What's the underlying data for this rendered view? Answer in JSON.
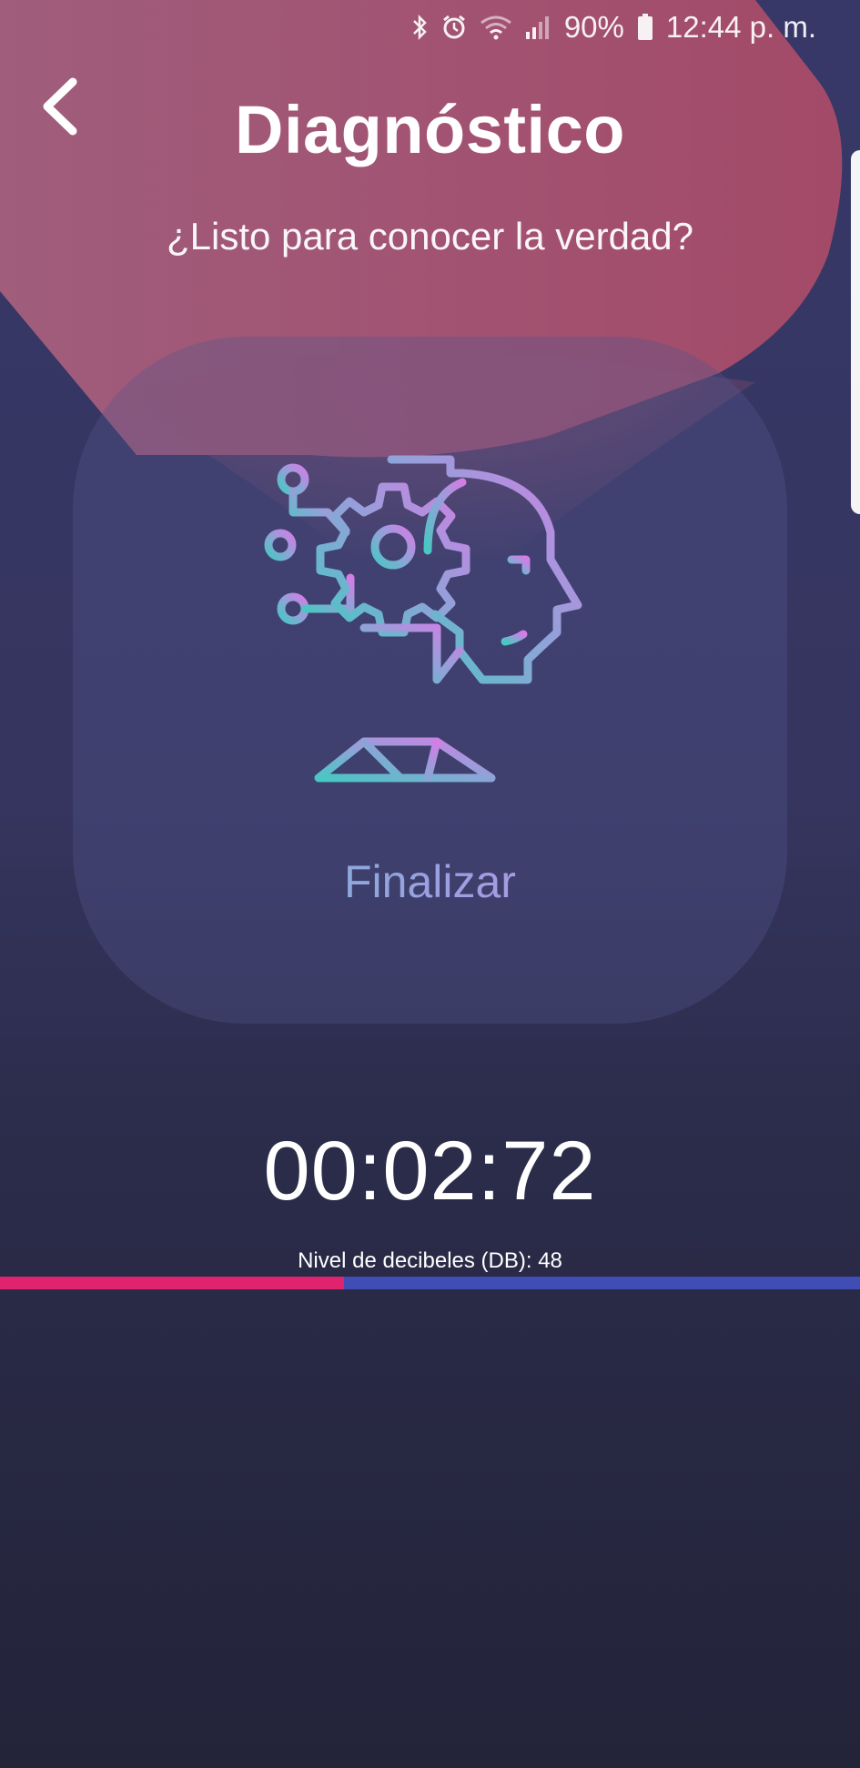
{
  "status_bar": {
    "battery": "90%",
    "time": "12:44 p. m.",
    "icons": [
      "bluetooth-icon",
      "alarm-icon",
      "wifi-icon",
      "signal-icon",
      "battery-icon"
    ]
  },
  "header": {
    "title": "Diagnóstico",
    "subtitle": "¿Listo para conocer la verdad?"
  },
  "card": {
    "icon": "robot-head-gear-icon",
    "action_label": "Finalizar"
  },
  "timer": {
    "value": "00:02:72"
  },
  "decibel": {
    "label": "Nivel de decibeles (DB): 48",
    "level": 0.4
  },
  "colors": {
    "background": "#373868",
    "accent_pink": "#e0236f",
    "accent_blue": "#3f4db4",
    "header_shape": "#a24e6e"
  }
}
